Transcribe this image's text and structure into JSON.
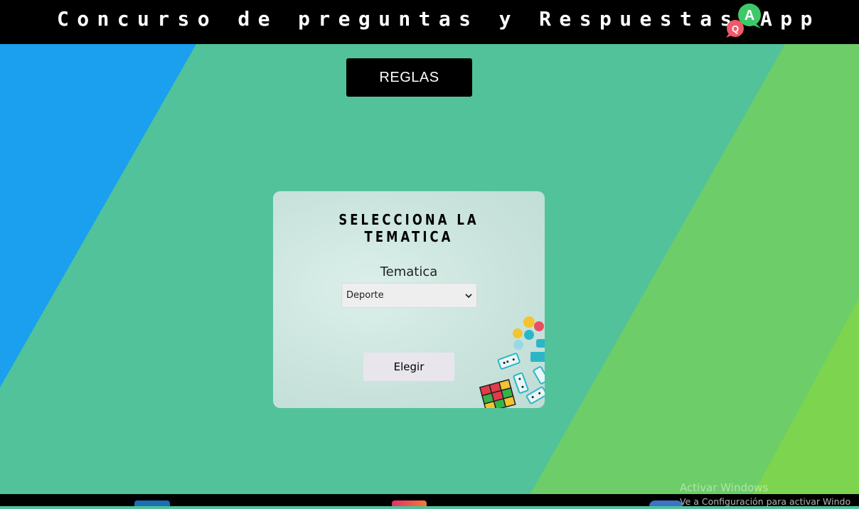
{
  "header": {
    "title": "Concurso de preguntas y Respuestas App",
    "logo_icon": "quiz-app-logo"
  },
  "rules_button": {
    "label": "REGLAS"
  },
  "card": {
    "title": "SELECCIONA LA TEMATICA",
    "select_label": "Tematica",
    "select_value": "Deporte",
    "choose_button": "Elegir"
  },
  "watermark": {
    "line1": "Activar Windows",
    "line2": "Ve a Configuración para activar Windo"
  },
  "colors": {
    "left_stripe": "#1aa0ef",
    "center": "#52c29a",
    "right_stripe": "#6dcd68",
    "far_right": "#7dd44e",
    "header": "#000000"
  }
}
